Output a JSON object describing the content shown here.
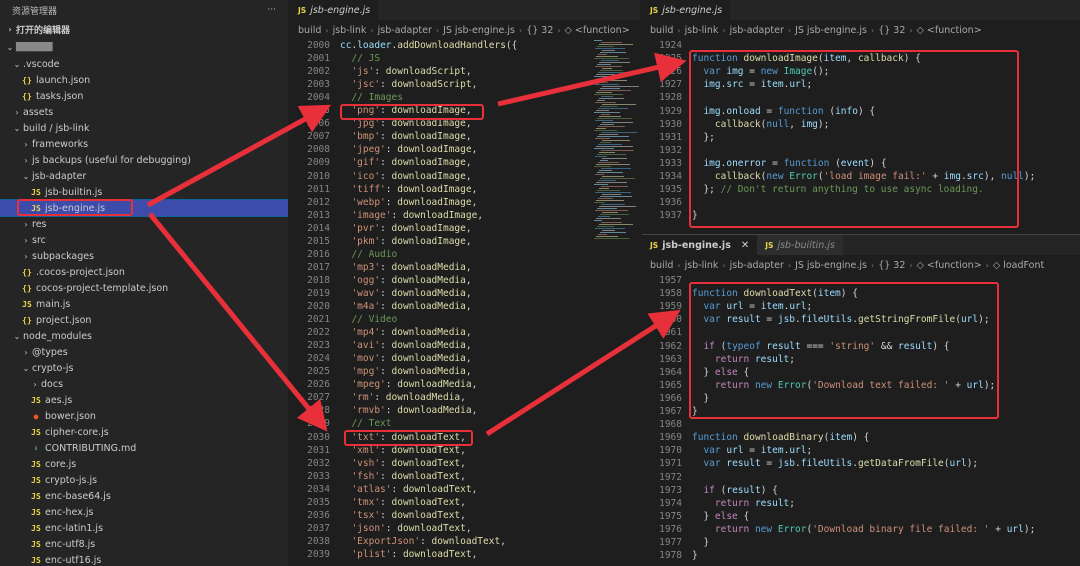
{
  "sidebar": {
    "title": "资源管理器",
    "more": "···",
    "section": "打开的编辑器",
    "workspace": "▇▇▇▇▇▇",
    "items": [
      {
        "label": ".vscode",
        "indent": 1,
        "type": "folder",
        "open": true
      },
      {
        "label": "launch.json",
        "indent": 2,
        "type": "json"
      },
      {
        "label": "tasks.json",
        "indent": 2,
        "type": "json"
      },
      {
        "label": "assets",
        "indent": 1,
        "type": "folder",
        "open": false
      },
      {
        "label": "build / jsb-link",
        "indent": 1,
        "type": "folder",
        "open": true
      },
      {
        "label": "frameworks",
        "indent": 2,
        "type": "folder",
        "open": false
      },
      {
        "label": "js backups (useful for debugging)",
        "indent": 2,
        "type": "folder",
        "open": false
      },
      {
        "label": "jsb-adapter",
        "indent": 2,
        "type": "folder",
        "open": true
      },
      {
        "label": "jsb-builtin.js",
        "indent": 3,
        "type": "js"
      },
      {
        "label": "jsb-engine.js",
        "indent": 3,
        "type": "js",
        "selected": true
      },
      {
        "label": "res",
        "indent": 2,
        "type": "folder",
        "open": false
      },
      {
        "label": "src",
        "indent": 2,
        "type": "folder",
        "open": false
      },
      {
        "label": "subpackages",
        "indent": 2,
        "type": "folder",
        "open": false
      },
      {
        "label": ".cocos-project.json",
        "indent": 2,
        "type": "json"
      },
      {
        "label": "cocos-project-template.json",
        "indent": 2,
        "type": "json"
      },
      {
        "label": "main.js",
        "indent": 2,
        "type": "js"
      },
      {
        "label": "project.json",
        "indent": 2,
        "type": "json"
      },
      {
        "label": "node_modules",
        "indent": 1,
        "type": "folder",
        "open": true
      },
      {
        "label": "@types",
        "indent": 2,
        "type": "folder",
        "open": false
      },
      {
        "label": "crypto-js",
        "indent": 2,
        "type": "folder",
        "open": true
      },
      {
        "label": "docs",
        "indent": 3,
        "type": "folder",
        "open": false
      },
      {
        "label": "aes.js",
        "indent": 3,
        "type": "js"
      },
      {
        "label": "bower.json",
        "indent": 3,
        "type": "bower"
      },
      {
        "label": "cipher-core.js",
        "indent": 3,
        "type": "js"
      },
      {
        "label": "CONTRIBUTING.md",
        "indent": 3,
        "type": "md"
      },
      {
        "label": "core.js",
        "indent": 3,
        "type": "js"
      },
      {
        "label": "crypto-js.js",
        "indent": 3,
        "type": "js"
      },
      {
        "label": "enc-base64.js",
        "indent": 3,
        "type": "js"
      },
      {
        "label": "enc-hex.js",
        "indent": 3,
        "type": "js"
      },
      {
        "label": "enc-latin1.js",
        "indent": 3,
        "type": "js"
      },
      {
        "label": "enc-utf8.js",
        "indent": 3,
        "type": "js"
      },
      {
        "label": "enc-utf16.js",
        "indent": 3,
        "type": "js"
      }
    ]
  },
  "mid_editor": {
    "tab": "jsb-engine.js",
    "tab_icon": "JS",
    "breadcrumb": [
      "build",
      "jsb-link",
      "jsb-adapter",
      "JS jsb-engine.js",
      "{} 32",
      "◇ <function>"
    ],
    "lines": [
      {
        "n": "2000",
        "t": "cc.loader.addDownloadHandlers({"
      },
      {
        "n": "2001",
        "t": "  // JS"
      },
      {
        "n": "2002",
        "t": "  'js': downloadScript,"
      },
      {
        "n": "2003",
        "t": "  'jsc': downloadScript,"
      },
      {
        "n": "2004",
        "t": "  // Images"
      },
      {
        "n": "2005",
        "t": "  'png': downloadImage,"
      },
      {
        "n": "2006",
        "t": "  'jpg': downloadImage,"
      },
      {
        "n": "2007",
        "t": "  'bmp': downloadImage,"
      },
      {
        "n": "2008",
        "t": "  'jpeg': downloadImage,"
      },
      {
        "n": "2009",
        "t": "  'gif': downloadImage,"
      },
      {
        "n": "2010",
        "t": "  'ico': downloadImage,"
      },
      {
        "n": "2011",
        "t": "  'tiff': downloadImage,"
      },
      {
        "n": "2012",
        "t": "  'webp': downloadImage,"
      },
      {
        "n": "2013",
        "t": "  'image': downloadImage,"
      },
      {
        "n": "2014",
        "t": "  'pvr': downloadImage,"
      },
      {
        "n": "2015",
        "t": "  'pkm': downloadImage,"
      },
      {
        "n": "2016",
        "t": "  // Audio"
      },
      {
        "n": "2017",
        "t": "  'mp3': downloadMedia,"
      },
      {
        "n": "2018",
        "t": "  'ogg': downloadMedia,"
      },
      {
        "n": "2019",
        "t": "  'wav': downloadMedia,"
      },
      {
        "n": "2020",
        "t": "  'm4a': downloadMedia,"
      },
      {
        "n": "2021",
        "t": "  // Video"
      },
      {
        "n": "2022",
        "t": "  'mp4': downloadMedia,"
      },
      {
        "n": "2023",
        "t": "  'avi': downloadMedia,"
      },
      {
        "n": "2024",
        "t": "  'mov': downloadMedia,"
      },
      {
        "n": "2025",
        "t": "  'mpg': downloadMedia,"
      },
      {
        "n": "2026",
        "t": "  'mpeg': downloadMedia,"
      },
      {
        "n": "2027",
        "t": "  'rm': downloadMedia,"
      },
      {
        "n": "2028",
        "t": "  'rmvb': downloadMedia,"
      },
      {
        "n": "2029",
        "t": "  // Text"
      },
      {
        "n": "2030",
        "t": "  'txt': downloadText,"
      },
      {
        "n": "2031",
        "t": "  'xml': downloadText,"
      },
      {
        "n": "2032",
        "t": "  'vsh': downloadText,"
      },
      {
        "n": "2033",
        "t": "  'fsh': downloadText,"
      },
      {
        "n": "2034",
        "t": "  'atlas': downloadText,"
      },
      {
        "n": "2035",
        "t": "  'tmx': downloadText,"
      },
      {
        "n": "2036",
        "t": "  'tsx': downloadText,"
      },
      {
        "n": "2037",
        "t": "  'json': downloadText,"
      },
      {
        "n": "2038",
        "t": "  'ExportJson': downloadText,"
      },
      {
        "n": "2039",
        "t": "  'plist': downloadText,"
      }
    ]
  },
  "top_right_editor": {
    "tab": "jsb-engine.js",
    "tab_icon": "JS",
    "breadcrumb": [
      "build",
      "jsb-link",
      "jsb-adapter",
      "JS jsb-engine.js",
      "{} 32",
      "◇ <function>"
    ],
    "lines": [
      {
        "n": "1924",
        "t": ""
      },
      {
        "n": "1925",
        "t": "function downloadImage(item, callback) {"
      },
      {
        "n": "1926",
        "t": "  var img = new Image();"
      },
      {
        "n": "1927",
        "t": "  img.src = item.url;"
      },
      {
        "n": "1928",
        "t": ""
      },
      {
        "n": "1929",
        "t": "  img.onload = function (info) {"
      },
      {
        "n": "1930",
        "t": "    callback(null, img);"
      },
      {
        "n": "1931",
        "t": "  };"
      },
      {
        "n": "1932",
        "t": ""
      },
      {
        "n": "1933",
        "t": "  img.onerror = function (event) {"
      },
      {
        "n": "1934",
        "t": "    callback(new Error('load image fail:' + img.src), null);"
      },
      {
        "n": "1935",
        "t": "  }; // Don't return anything to use async loading."
      },
      {
        "n": "1936",
        "t": ""
      },
      {
        "n": "1937",
        "t": "}"
      }
    ]
  },
  "bottom_right_editor": {
    "tabs": [
      {
        "label": "jsb-engine.js",
        "icon": "JS",
        "close": "✕"
      },
      {
        "label": "jsb-builtin.js",
        "icon": "JS"
      }
    ],
    "breadcrumb": [
      "build",
      "jsb-link",
      "jsb-adapter",
      "JS jsb-engine.js",
      "{} 32",
      "◇ <function>",
      "◇ loadFont"
    ],
    "lines": [
      {
        "n": "1957",
        "t": ""
      },
      {
        "n": "1958",
        "t": "function downloadText(item) {"
      },
      {
        "n": "1959",
        "t": "  var url = item.url;"
      },
      {
        "n": "1960",
        "t": "  var result = jsb.fileUtils.getStringFromFile(url);"
      },
      {
        "n": "1961",
        "t": ""
      },
      {
        "n": "1962",
        "t": "  if (typeof result === 'string' && result) {"
      },
      {
        "n": "1963",
        "t": "    return result;"
      },
      {
        "n": "1964",
        "t": "  } else {"
      },
      {
        "n": "1965",
        "t": "    return new Error('Download text failed: ' + url);"
      },
      {
        "n": "1966",
        "t": "  }"
      },
      {
        "n": "1967",
        "t": "}"
      },
      {
        "n": "1968",
        "t": ""
      },
      {
        "n": "1969",
        "t": "function downloadBinary(item) {"
      },
      {
        "n": "1970",
        "t": "  var url = item.url;"
      },
      {
        "n": "1971",
        "t": "  var result = jsb.fileUtils.getDataFromFile(url);"
      },
      {
        "n": "1972",
        "t": ""
      },
      {
        "n": "1973",
        "t": "  if (result) {"
      },
      {
        "n": "1974",
        "t": "    return result;"
      },
      {
        "n": "1975",
        "t": "  } else {"
      },
      {
        "n": "1976",
        "t": "    return new Error('Download binary file failed: ' + url);"
      },
      {
        "n": "1977",
        "t": "  }"
      },
      {
        "n": "1978",
        "t": "}"
      }
    ]
  },
  "colors": {
    "arrow": "#e8303a",
    "selection": "#3d4baa",
    "keyword": "#569cd6",
    "string": "#ce9178",
    "function": "#dcdcaa",
    "comment": "#6a9955"
  }
}
